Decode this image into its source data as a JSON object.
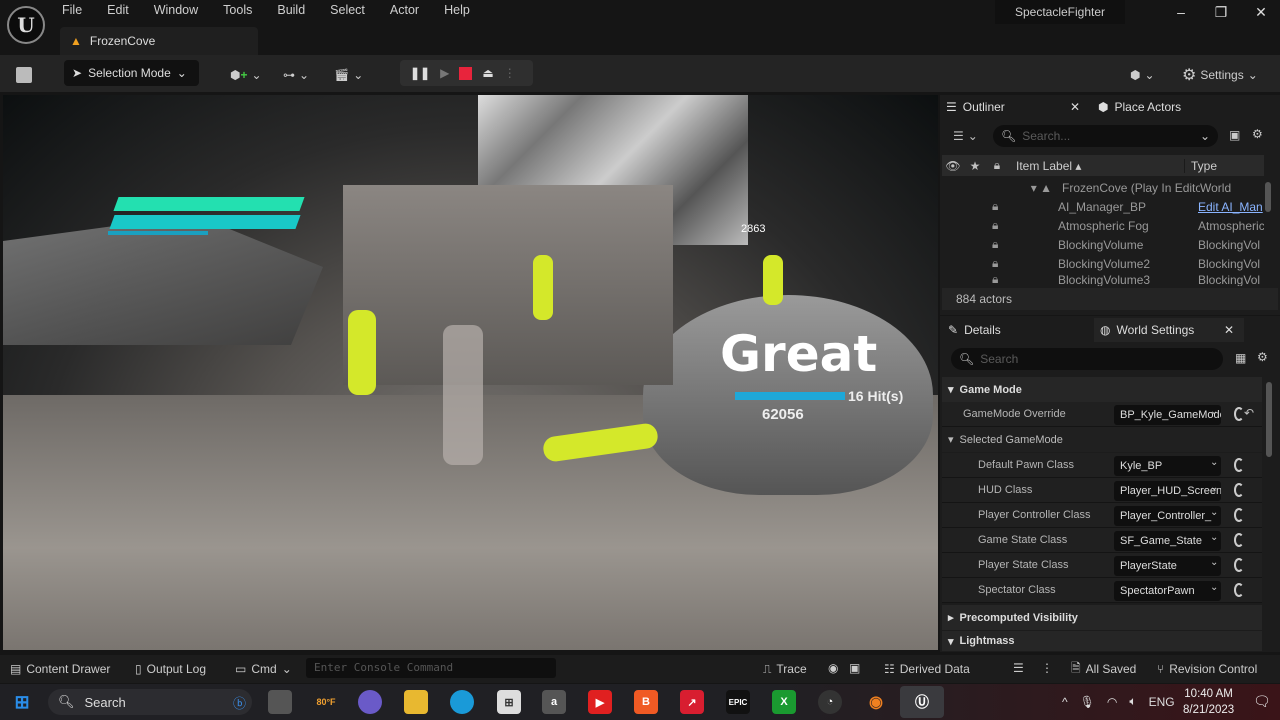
{
  "menu": [
    "File",
    "Edit",
    "Window",
    "Tools",
    "Build",
    "Select",
    "Actor",
    "Help"
  ],
  "level_tab": "FrozenCove",
  "project_name": "SpectacleFighter",
  "toolbar": {
    "selection_mode": "Selection Mode",
    "settings": "Settings"
  },
  "hud": {
    "health_fraction": 0.95,
    "rating": "Great",
    "hits": "16 Hit(s)",
    "score": "62056",
    "damage": "2863",
    "combo_fraction": 0.75
  },
  "outliner": {
    "tab": "Outliner",
    "tab2": "Place Actors",
    "search_placeholder": "Search...",
    "col_label": "Item Label",
    "col_type": "Type",
    "rows": [
      {
        "label": "FrozenCove (Play In Edito",
        "type": "World"
      },
      {
        "label": "AI_Manager_BP",
        "type": "Edit AI_Man"
      },
      {
        "label": "Atmospheric Fog",
        "type": "Atmospheric"
      },
      {
        "label": "BlockingVolume",
        "type": "BlockingVol"
      },
      {
        "label": "BlockingVolume2",
        "type": "BlockingVol"
      },
      {
        "label": "BlockingVolume3",
        "type": "BlockingVol"
      }
    ],
    "count": "884 actors"
  },
  "details": {
    "tab": "Details",
    "tab2": "World Settings",
    "search_placeholder": "Search",
    "sections": {
      "game_mode": "Game Mode",
      "selected": "Selected GameMode",
      "precomputed": "Precomputed Visibility",
      "lightmass": "Lightmass"
    },
    "override": {
      "label": "GameMode Override",
      "value": "BP_Kyle_GameMode"
    },
    "props": [
      {
        "label": "Default Pawn Class",
        "value": "Kyle_BP"
      },
      {
        "label": "HUD Class",
        "value": "Player_HUD_Screen"
      },
      {
        "label": "Player Controller Class",
        "value": "Player_Controller_"
      },
      {
        "label": "Game State Class",
        "value": "SF_Game_State"
      },
      {
        "label": "Player State Class",
        "value": "PlayerState"
      },
      {
        "label": "Spectator Class",
        "value": "SpectatorPawn"
      }
    ]
  },
  "status": {
    "content_drawer": "Content Drawer",
    "output_log": "Output Log",
    "cmd": "Cmd",
    "console_placeholder": "Enter Console Command",
    "trace": "Trace",
    "derived": "Derived Data",
    "saved": "All Saved",
    "revision": "Revision Control"
  },
  "taskbar": {
    "search": "Search",
    "weather": "80°F",
    "lang": "ENG",
    "time": "10:40 AM",
    "date": "8/21/2023"
  }
}
